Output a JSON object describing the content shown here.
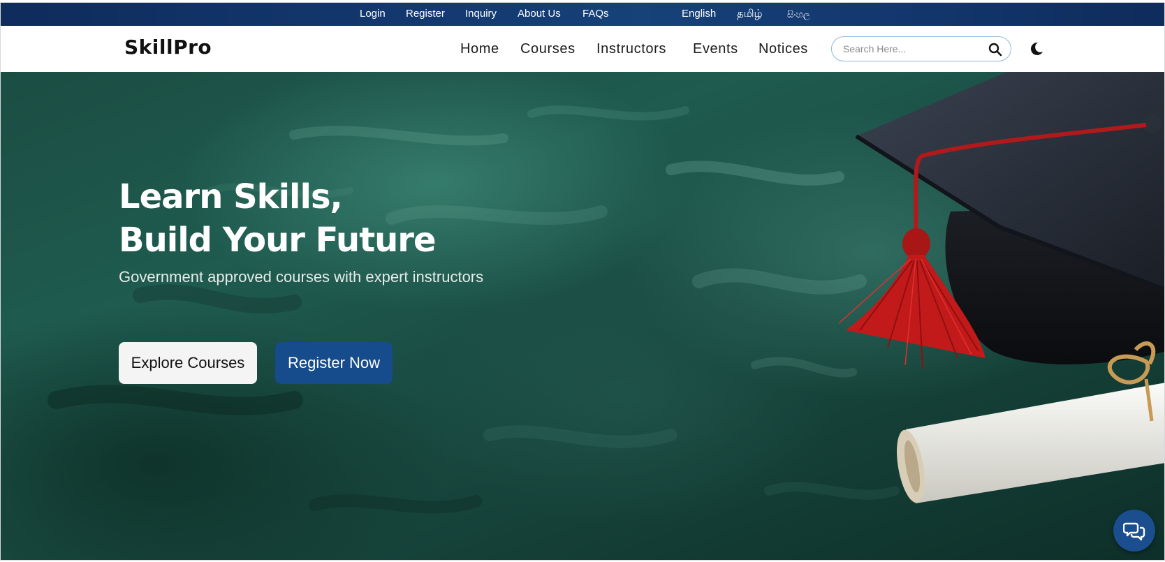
{
  "topbar": {
    "links": [
      "Login",
      "Register",
      "Inquiry",
      "About Us",
      "FAQs"
    ],
    "languages": [
      "English",
      "தமிழ்",
      "සිංහල"
    ]
  },
  "header": {
    "logo": "SkillPro",
    "nav": [
      "Home",
      "Courses",
      "Instructors",
      "Events",
      "Notices"
    ],
    "search_placeholder": "Search Here...",
    "search_icon": "search-icon",
    "theme_icon": "moon-icon"
  },
  "hero": {
    "title_line1": "Learn Skills,",
    "title_line2": "Build Your Future",
    "subtitle": "Government approved courses with expert instructors",
    "primary_button": "Explore Courses",
    "secondary_button": "Register Now",
    "chat_icon": "chat-bubbles-icon"
  },
  "colors": {
    "topbar": "#13386f",
    "brand_blue": "#164b8c",
    "hero_green": "#1f5b4f",
    "tassel_red": "#c21a1a"
  }
}
